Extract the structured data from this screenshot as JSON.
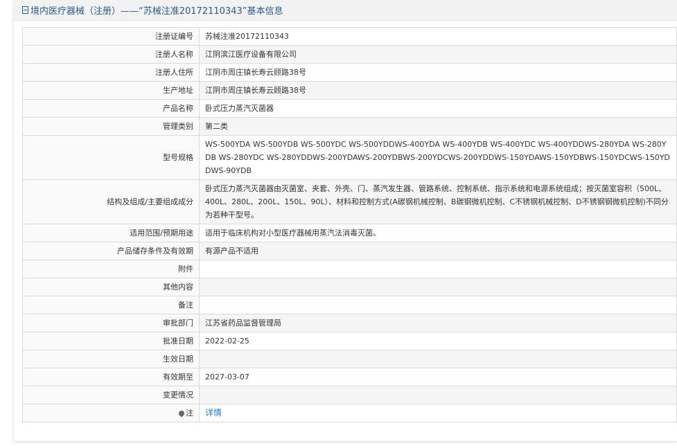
{
  "header": {
    "title": "境内医疗器械（注册）——“苏械注准20172110343”基本信息"
  },
  "rows": [
    {
      "label": "注册证编号",
      "value": "苏械注准20172110343"
    },
    {
      "label": "注册人名称",
      "value": "江阴滨江医疗设备有限公司"
    },
    {
      "label": "注册人住所",
      "value": "江阴市周庄镇长寿云顾路38号"
    },
    {
      "label": "生产地址",
      "value": "江阴市周庄镇长寿云顾路38号"
    },
    {
      "label": "产品名称",
      "value": "卧式压力蒸汽灭菌器"
    },
    {
      "label": "管理类别",
      "value": "第二类"
    },
    {
      "label": "型号规格",
      "value": "WS-500YDA WS-500YDB WS-500YDC WS-500YDDWS-400YDA WS-400YDB WS-400YDC WS-400YDDWS-280YDA WS-280YDB WS-280YDC WS-280YDDWS-200YDAWS-200YDBWS-200YDCWS-200YDDWS-150YDAWS-150YDBWS-150YDCWS-150YDDWS-90YDB"
    },
    {
      "label": "结构及组成/主要组成成分",
      "value": "卧式压力蒸汽灭菌器由灭菌室、夹套、外壳、门、蒸汽发生器、管路系统、控制系统、指示系统和电源系统组成；按灭菌室容积（500L、400L、280L、200L、150L、90L）、材料和控制方式(A碳钢机械控制、B碳钢微机控制、C不锈钢机械控制、D不锈钢钢微机控制)不同分为若种干型号。"
    },
    {
      "label": "适用范围/预期用途",
      "value": "适用于临床机构对小型医疗器械用蒸汽法消毒灭菌。"
    },
    {
      "label": "产品储存条件及有效期",
      "value": "有源产品不适用"
    },
    {
      "label": "附件",
      "value": ""
    },
    {
      "label": "其他内容",
      "value": ""
    },
    {
      "label": "备注",
      "value": ""
    },
    {
      "label": "审批部门",
      "value": "江苏省药品监督管理局"
    },
    {
      "label": "批准日期",
      "value": "2022-02-25"
    },
    {
      "label": "生效日期",
      "value": ""
    },
    {
      "label": "有效期至",
      "value": "2027-03-07"
    },
    {
      "label": "变更情况",
      "value": ""
    }
  ],
  "note": {
    "label": "注",
    "icon": "pin-icon",
    "link_text": "详情"
  },
  "colors": {
    "header_text": "#2b5a8a",
    "link": "#2a7ac0",
    "alt_row": "#f5f5f5",
    "border": "#d9d9d9"
  }
}
